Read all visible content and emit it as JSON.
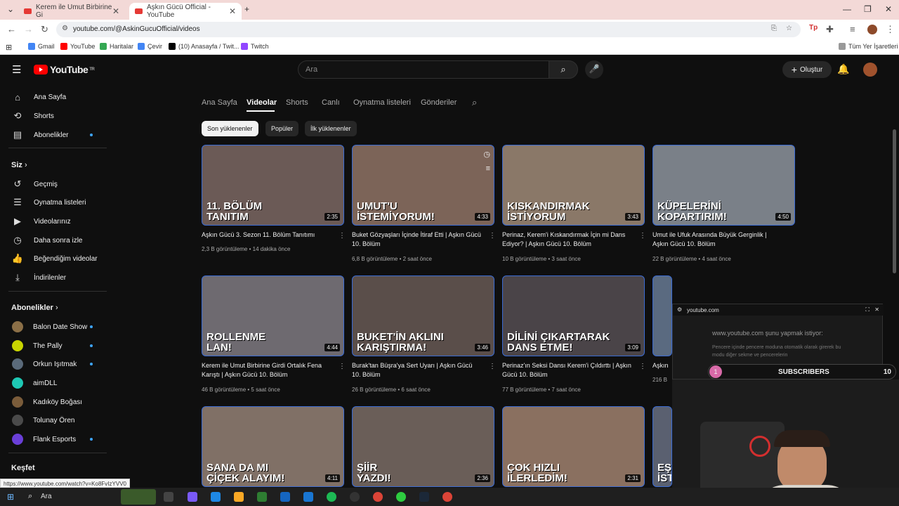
{
  "browser": {
    "tabs": [
      {
        "title": "Kerem ile Umut Birbirine Gi"
      },
      {
        "title": "Aşkın Gücü Official - YouTube"
      }
    ],
    "url": "youtube.com/@AskinGucuOfficial/videos",
    "bookmarks": [
      "Gmail",
      "YouTube",
      "Haritalar",
      "Çevir",
      "(10) Anasayfa / Twit...",
      "Twitch"
    ],
    "all_bookmarks": "Tüm Yer İşaretleri",
    "status_url": "https://www.youtube.com/watch?v=Ko8FvIzYVV0"
  },
  "youtube": {
    "logo_text": "YouTube",
    "logo_region": "TR",
    "search_placeholder": "Ara",
    "create_label": "Oluştur",
    "sidebar": {
      "main": [
        {
          "label": "Ana Sayfa",
          "icon": "home-icon"
        },
        {
          "label": "Shorts",
          "icon": "shorts-icon"
        },
        {
          "label": "Abonelikler",
          "icon": "subscriptions-icon"
        }
      ],
      "you_header": "Siz",
      "you": [
        {
          "label": "Geçmiş",
          "icon": "history-icon"
        },
        {
          "label": "Oynatma listeleri",
          "icon": "playlists-icon"
        },
        {
          "label": "Videolarınız",
          "icon": "your-videos-icon"
        },
        {
          "label": "Daha sonra izle",
          "icon": "watch-later-icon"
        },
        {
          "label": "Beğendiğim videolar",
          "icon": "liked-icon"
        },
        {
          "label": "İndirilenler",
          "icon": "downloads-icon"
        }
      ],
      "subs_header": "Abonelikler",
      "subscriptions": [
        {
          "label": "Balon Date Show",
          "color": "#8b6f47"
        },
        {
          "label": "The Pally",
          "color": "#c8d400"
        },
        {
          "label": "Orkun Işıtmak",
          "color": "#5a6a7a"
        },
        {
          "label": "aimDLL",
          "color": "#1ec8b4"
        },
        {
          "label": "Kadıköy Boğası",
          "color": "#7a5c3a"
        },
        {
          "label": "Tolunay Ören",
          "color": "#4a4a4a"
        },
        {
          "label": "Flank Esports",
          "color": "#6a3fd8"
        }
      ],
      "explore_header": "Keşfet"
    },
    "channel_tabs": [
      "Ana Sayfa",
      "Videolar",
      "Shorts",
      "Canlı",
      "Oynatma listeleri",
      "Gönderiler"
    ],
    "chips": [
      "Son yüklenenler",
      "Popüler",
      "İlk yüklenenler"
    ],
    "videos": [
      {
        "caption": "11. BÖLÜM",
        "caption2": "TANITIM",
        "duration": "2:35",
        "title": "Aşkın Gücü 3. Sezon 11. Bölüm Tanıtımı",
        "meta": "2,3 B görüntüleme • 14 dakika önce",
        "bg": "#6b5a56"
      },
      {
        "caption": "UMUT'U",
        "caption2": "İSTEMİYORUM!",
        "duration": "4:33",
        "title": "Buket Gözyaşları İçinde İtiraf Etti | Aşkın Gücü 10. Bölüm",
        "meta": "6,8 B görüntüleme • 2 saat önce",
        "bg": "#7c6458"
      },
      {
        "caption": "KISKANDIRMAK",
        "caption2": "İSTİYORUM",
        "duration": "3:43",
        "title": "Perinaz, Kerem'i Kıskandırmak İçin mi Dans Ediyor? | Aşkın Gücü 10. Bölüm",
        "meta": "10 B görüntüleme • 3 saat önce",
        "bg": "#8a7868"
      },
      {
        "caption": "KÜPELERİNİ",
        "caption2": "KOPARTIRIM!",
        "duration": "4:50",
        "title": "Umut ile Ufuk Arasında Büyük Gerginlik | Aşkın Gücü 10. Bölüm",
        "meta": "22 B görüntüleme • 4 saat önce",
        "bg": "#7a8088"
      },
      {
        "caption": "ROLLENME",
        "caption2": "LAN!",
        "duration": "4:44",
        "title": "Kerem ile Umut Birbirine Girdi Ortalık Fena Karıştı | Aşkın Gücü 10. Bölüm",
        "meta": "46 B görüntüleme • 5 saat önce",
        "bg": "#6e6a70"
      },
      {
        "caption": "BUKET'İN AKLINI",
        "caption2": "KARIŞTIRMA!",
        "duration": "3:46",
        "title": "Burak'tan Büşra'ya Sert Uyarı | Aşkın Gücü 10. Bölüm",
        "meta": "26 B görüntüleme • 6 saat önce",
        "bg": "#5a4e4a"
      },
      {
        "caption": "DİLİNİ ÇIKARTARAK",
        "caption2": "DANS ETME!",
        "duration": "3:09",
        "title": "Perinaz'ın Seksi Dansı Kerem'i Çıldırttı | Aşkın Gücü 10. Bölüm",
        "meta": "77 B görüntüleme • 7 saat önce",
        "bg": "#4a4448"
      },
      {
        "caption": "",
        "caption2": "",
        "duration": "",
        "title": "Aşkın",
        "meta": "216 B",
        "bg": "#5a6a80"
      },
      {
        "caption": "SANA DA MI",
        "caption2": "ÇİÇEK ALAYIM!",
        "duration": "4:11",
        "title": "",
        "meta": "",
        "bg": "#807066"
      },
      {
        "caption": "ŞİİR",
        "caption2": "YAZDI!",
        "duration": "2:36",
        "title": "",
        "meta": "",
        "bg": "#6a5e58"
      },
      {
        "caption": "ÇOK HIZLI",
        "caption2": "İLERLEDİM!",
        "duration": "2:31",
        "title": "",
        "meta": "",
        "bg": "#8a7060"
      },
      {
        "caption": "EŞ",
        "caption2": "İST",
        "duration": "",
        "title": "",
        "meta": "",
        "bg": "#5a6070"
      }
    ]
  },
  "pip": {
    "site": "youtube.com",
    "message": "www.youtube.com şunu yapmak istiyor:",
    "detail": "Pencere içinde pencere moduna otomatik olarak girerek bu modu diğer sekme ve pencerelerin"
  },
  "subscribers_overlay": {
    "label": "SUBSCRIBERS",
    "left": "1",
    "right": "10"
  },
  "taskbar": {
    "search": "Ara"
  }
}
